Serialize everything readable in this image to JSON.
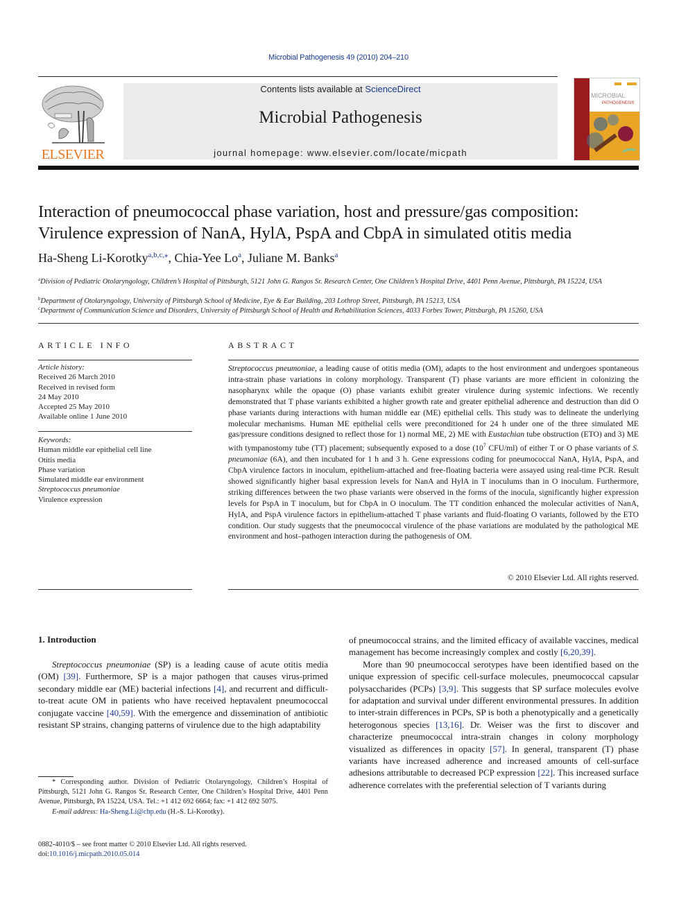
{
  "header": {
    "citation_line": "Microbial Pathogenesis 49 (2010) 204–210",
    "contents_prefix": "Contents lists available at ",
    "contents_link": "ScienceDirect",
    "journal_name": "Microbial Pathogenesis",
    "homepage_prefix": "journal homepage: ",
    "homepage_url": "www.elsevier.com/locate/micpath",
    "publisher_logo_text": "ELSEVIER",
    "publisher_logo_icon": "elsevier-tree-icon",
    "cover": {
      "title_line1": "MICROBIAL",
      "title_line2": "PATHOGENESIS",
      "icon": "journal-cover-image"
    },
    "colors": {
      "link": "#1f3a93",
      "elsevier_orange": "#e87722",
      "banner_bg": "#ebebeb"
    }
  },
  "article": {
    "title_line1": "Interaction of pneumococcal phase variation, host and pressure/gas composition:",
    "title_line2": "Virulence expression of NanA, HylA, PspA and CbpA in simulated otitis media",
    "authors": [
      {
        "name": "Ha-Sheng Li-Korotky",
        "marks": "a,b,c,⁎",
        "sep": ", "
      },
      {
        "name": "Chia-Yee Lo",
        "marks": "a",
        "sep": ", "
      },
      {
        "name": "Juliane M. Banks",
        "marks": "a",
        "sep": ""
      }
    ],
    "affiliations": [
      {
        "mark": "a",
        "text": "Division of Pediatric Otolaryngology, Children’s Hospital of Pittsburgh, 5121 John G. Rangos Sr. Research Center, One Children’s Hospital Drive, 4401 Penn Avenue, Pittsburgh, PA 15224, USA"
      },
      {
        "mark": "b",
        "text": "Department of Otolaryngology, University of Pittsburgh School of Medicine, Eye & Ear Building, 203 Lothrop Street, Pittsburgh, PA 15213, USA"
      },
      {
        "mark": "c",
        "text": "Department of Communication Science and Disorders, University of Pittsburgh School of Health and Rehabilitation Sciences, 4033 Forbes Tower, Pittsburgh, PA 15260, USA"
      }
    ]
  },
  "article_info": {
    "heading": "ARTICLE INFO",
    "history_label": "Article history:",
    "history": [
      "Received 26 March 2010",
      "Received in revised form",
      "24 May 2010",
      "Accepted 25 May 2010",
      "Available online 1 June 2010"
    ],
    "keywords_label": "Keywords:",
    "keywords": [
      {
        "text": "Human middle ear epithelial cell line",
        "italic": false
      },
      {
        "text": "Otitis media",
        "italic": false
      },
      {
        "text": "Phase variation",
        "italic": false
      },
      {
        "text": "Simulated middle ear environment",
        "italic": false
      },
      {
        "text": "Streptococcus pneumoniae",
        "italic": true
      },
      {
        "text": "Virulence expression",
        "italic": false
      }
    ]
  },
  "abstract": {
    "heading": "ABSTRACT",
    "species_italic": "Streptococcus pneumoniae",
    "part1": ", a leading cause of otitis media (OM), adapts to the host environment and undergoes spontaneous intra-strain phase variations in colony morphology. Transparent (T) phase variants are more efficient in colonizing the nasopharynx while the opaque (O) phase variants exhibit greater virulence during systemic infections. We recently demonstrated that T phase variants exhibited a higher growth rate and greater epithelial adherence and destruction than did O phase variants during interactions with human middle ear (ME) epithelial cells. This study was to delineate the underlying molecular mechanisms. Human ME epithelial cells were preconditioned for 24 h under one of the three simulated ME gas/pressure conditions designed to reflect those for 1) normal ME, 2) ME with ",
    "eustachian_italic": "Eustachian",
    "part2": " tube obstruction (ETO) and 3) ME with tympanostomy tube (TT) placement; subsequently exposed to a dose (10",
    "dose_exponent": "7",
    "part3": " CFU/ml) of either T or O phase variants of ",
    "s_pneumoniae_italic": "S. pneumoniae",
    "part4": " (6A), and then incubated for 1 h and 3 h. Gene expressions coding for pneumococcal NanA, HylA, PspA, and CbpA virulence factors in inoc­ulum, epithelium-attached and free-floating bacteria were assayed using real-time PCR. Result showed significantly higher basal expression levels for NanA and HylA in T inoculums than in O inoculum. Furthermore, striking differences between the two phase variants were observed in the forms of the inocula, significantly higher expression levels for PspA in T inoculum, but for CbpA in O inoculum. The TT condition enhanced the molecular activities of NanA, HylA, and PspA virulence factors in epithelium-attached T phase variants and fluid-floating O variants, followed by the ETO condition. Our study suggests that the pneumococcal virulence of the phase variations are modulated by the pathological ME environment and host–pathogen interaction during the pathogenesis of OM.",
    "copyright": "© 2010 Elsevier Ltd. All rights reserved."
  },
  "introduction": {
    "heading": "1.  Introduction",
    "left_col": {
      "p1_italic": "Streptococcus pneumoniae",
      "p1_a": " (SP) is a leading cause of acute otitis media (OM) ",
      "ref1": "[39]",
      "p1_b": ". Furthermore, SP is a major pathogen that causes virus-primed secondary middle ear (ME) bacterial infections ",
      "ref2": "[4]",
      "p1_c": ", and recurrent and difficult-to-treat acute OM in patients who have received heptavalent pneumococcal conjugate vaccine ",
      "ref3": "[40,59]",
      "p1_d": ". With the emergence and dissemination of antibiotic resistant SP strains, changing patterns of virulence due to the high adaptability"
    },
    "right_col": {
      "p1_a": "of pneumococcal strains, and the limited efficacy of available vaccines, medical management has become increasingly complex and costly ",
      "ref1": "[6,20,39]",
      "p1_b": ".",
      "p2_a": "More than 90 pneumococcal serotypes have been identified based on the unique expression of specific cell-surface molecules, pneumococcal capsular polysaccharides (PCPs) ",
      "ref2": "[3,9]",
      "p2_b": ". This suggests that SP surface molecules evolve for adaptation and survival under different environmental pressures. In addition to inter-strain differences in PCPs, SP is both a phenotypically and a genetically heterogonous species ",
      "ref3": "[13,16]",
      "p2_c": ". Dr. Weiser was the first to discover and characterize pneumococcal intra-strain changes in colony morphology visualized as differences in opacity ",
      "ref4": "[57]",
      "p2_d": ". In general, transparent (T) phase variants have increased adherence and increased amounts of cell-surface adhesions attributable to decreased PCP expression ",
      "ref5": "[22]",
      "p2_e": ". This increased surface adherence correlates with the preferential selection of T variants during"
    }
  },
  "footnote": {
    "mark": "*",
    "text": " Corresponding author. Division of Pediatric Otolaryngology, Children’s Hospital of Pittsburgh, 5121 John G. Rangos Sr. Research Center, One Children’s Hospital Drive, 4401 Penn Avenue, Pittsburgh, PA 15224, USA. Tel.: +1 412 692 6664; fax: +1 412 692 5075.",
    "email_label": "E-mail address:",
    "email": "Ha-Sheng.Li@chp.edu",
    "email_owner": " (H.-S. Li-Korotky)."
  },
  "front_matter": {
    "issn_line": "0882-4010/$ – see front matter © 2010 Elsevier Ltd. All rights reserved.",
    "doi_prefix": "doi:",
    "doi": "10.1016/j.micpath.2010.05.014"
  }
}
